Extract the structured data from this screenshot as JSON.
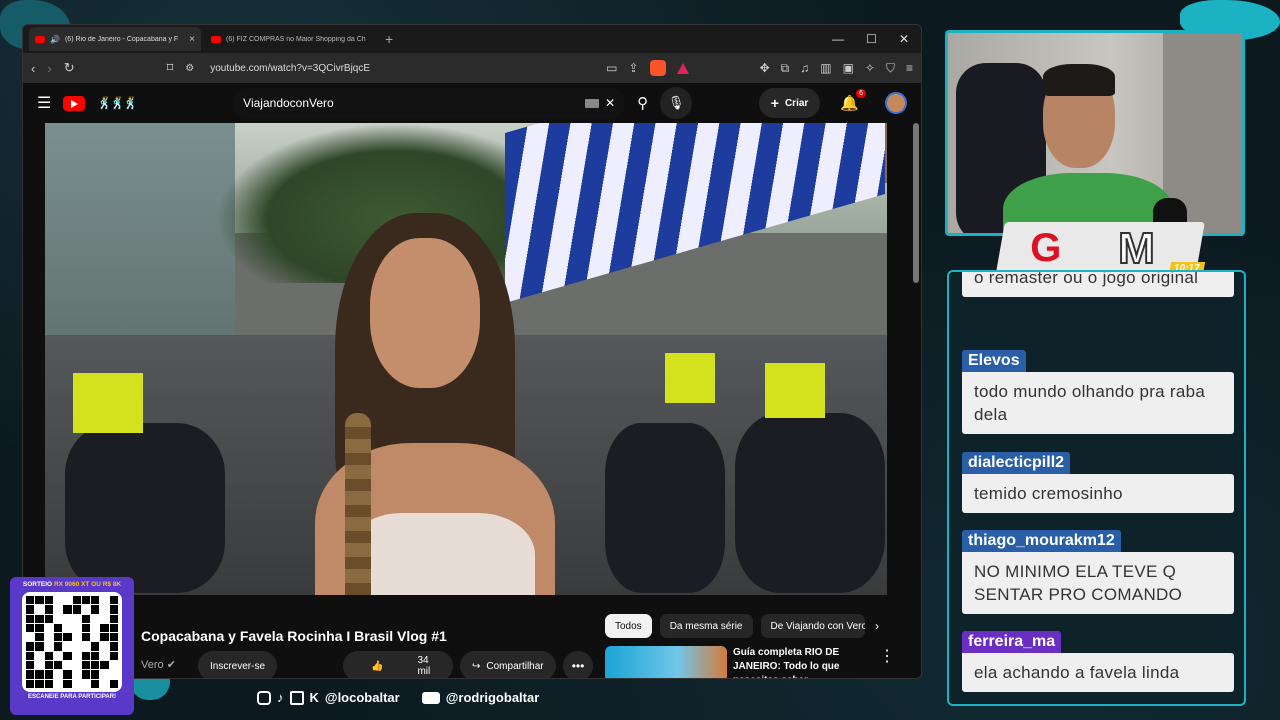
{
  "browser": {
    "tabs": [
      {
        "title": "(6) Rio de Janeiro - Copacabana y F",
        "active": true
      },
      {
        "title": "(6) FIZ COMPRAS no Maior Shopping da Ch",
        "active": false
      }
    ],
    "new_tab": "+",
    "url": "youtube.com/watch?v=3QCivrBjqcE",
    "window_controls": {
      "minimize": "—",
      "maximize": "☐",
      "close": "✕"
    }
  },
  "youtube": {
    "search_query": "ViajandoconVero",
    "create_label": "Criar",
    "notification_count": "6",
    "video_title": "Copacabana y Favela Rocinha I Brasil Vlog #1",
    "channel_partial": "Vero",
    "subscribe_label": "Inscrever-se",
    "likes": "34 mil",
    "share_label": "Compartilhar",
    "chips": [
      "Todos",
      "Da mesma série",
      "De Viajando con Vero"
    ],
    "recommendation": {
      "title": "Guía completa RIO DE JANEIRO: Todo lo que necesitas saber ..."
    }
  },
  "stream": {
    "clock": "10:17",
    "chat": [
      {
        "user": "",
        "text": "o remaster ou o jogo original",
        "color": "#2a5fa8"
      },
      {
        "user": "Elevos",
        "text": "todo mundo olhando pra raba dela",
        "color": "#2a5fa8"
      },
      {
        "user": "dialecticpill2",
        "text": "temido cremosinho",
        "color": "#2a5fa8"
      },
      {
        "user": "thiago_mourakm12",
        "text": "NO MINIMO ELA TEVE Q SENTAR PRO COMANDO",
        "color": "#2a5fa8"
      },
      {
        "user": "ferreira_ma",
        "text": "ela achando a favela linda",
        "color": "#6a2fc2"
      }
    ],
    "qr": {
      "title_prefix": "SORTEIO",
      "title_highlight": "RX 9060 XT OU R$ 8K",
      "footer": "ESCANEIE PARA PARTICIPAR!"
    },
    "socials": {
      "handle_1": "@locobaltar",
      "handle_2": "@rodrigobaltar"
    }
  },
  "colors": {
    "accent": "#1bb3c4",
    "qr_bg": "#5a38c8",
    "yt_red": "#ff0000"
  }
}
